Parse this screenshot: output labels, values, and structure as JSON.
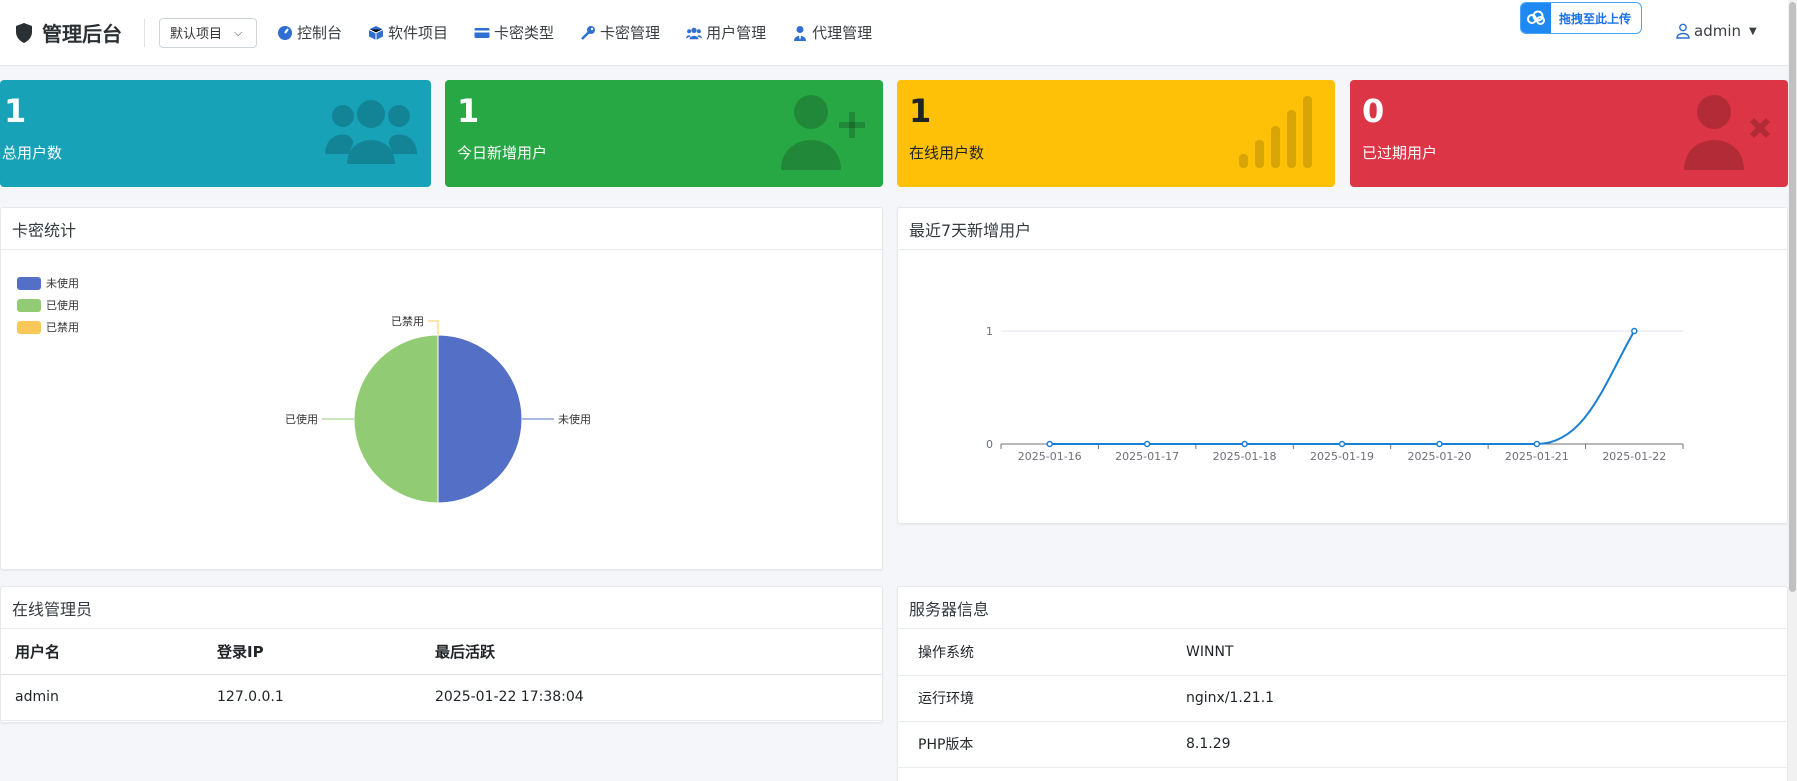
{
  "navbar": {
    "brand": "管理后台",
    "project_select": "默认项目",
    "items": [
      {
        "label": "控制台",
        "icon": "dashboard-icon"
      },
      {
        "label": "软件项目",
        "icon": "cube-icon"
      },
      {
        "label": "卡密类型",
        "icon": "credit-card-icon"
      },
      {
        "label": "卡密管理",
        "icon": "key-icon"
      },
      {
        "label": "用户管理",
        "icon": "users-icon"
      },
      {
        "label": "代理管理",
        "icon": "user-tie-icon"
      }
    ],
    "upload_button": "拖拽至此上传",
    "user": "admin"
  },
  "stats": [
    {
      "value": "1",
      "label": "总用户数",
      "icon": "users-icon",
      "color": "#17a2b8"
    },
    {
      "value": "1",
      "label": "今日新增用户",
      "icon": "user-plus-icon",
      "color": "#28a745"
    },
    {
      "value": "1",
      "label": "在线用户数",
      "icon": "signal-icon",
      "color": "#ffc107"
    },
    {
      "value": "0",
      "label": "已过期用户",
      "icon": "user-times-icon",
      "color": "#dc3545"
    }
  ],
  "card_stats": {
    "title": "卡密统计",
    "legend": [
      {
        "label": "未使用",
        "color": "#5470c6"
      },
      {
        "label": "已使用",
        "color": "#91cc75"
      },
      {
        "label": "已禁用",
        "color": "#fac858"
      }
    ]
  },
  "new_users": {
    "title": "最近7天新增用户"
  },
  "chart_data": [
    {
      "type": "pie",
      "categories": [
        "未使用",
        "已使用",
        "已禁用"
      ],
      "values": [
        1,
        1,
        0
      ],
      "colors": [
        "#5470c6",
        "#91cc75",
        "#fac858"
      ],
      "legend": "top-left"
    },
    {
      "type": "line",
      "x": [
        "2025-01-16",
        "2025-01-17",
        "2025-01-18",
        "2025-01-19",
        "2025-01-20",
        "2025-01-21",
        "2025-01-22"
      ],
      "series": [
        {
          "values": [
            0,
            0,
            0,
            0,
            0,
            0,
            1
          ]
        }
      ],
      "yticks": [
        0,
        1
      ],
      "ylim": [
        0,
        1
      ],
      "smooth": true,
      "grid": "horizontal",
      "color": "#1a7fd4"
    }
  ],
  "online_admins": {
    "title": "在线管理员",
    "columns": [
      "用户名",
      "登录IP",
      "最后活跃"
    ],
    "rows": [
      [
        "admin",
        "127.0.0.1",
        "2025-01-22 17:38:04"
      ]
    ]
  },
  "server_info": {
    "title": "服务器信息",
    "rows": [
      [
        "操作系统",
        "WINNT"
      ],
      [
        "运行环境",
        "nginx/1.21.1"
      ],
      [
        "PHP版本",
        "8.1.29"
      ]
    ]
  }
}
